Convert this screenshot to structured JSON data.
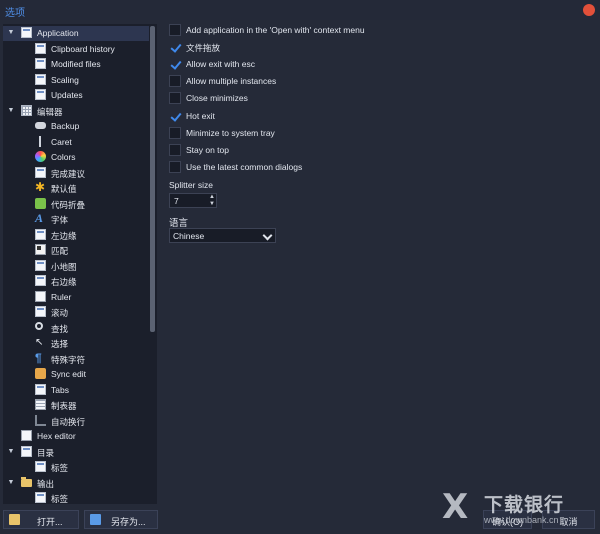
{
  "window": {
    "title": "选项"
  },
  "tree": {
    "items": [
      {
        "label": "Application",
        "icon": "window-icon",
        "level": 0,
        "expanded": true,
        "selected": true
      },
      {
        "label": "Clipboard history",
        "icon": "clipboard-icon",
        "level": 1
      },
      {
        "label": "Modified files",
        "icon": "page-icon",
        "level": 1
      },
      {
        "label": "Scaling",
        "icon": "scaling-icon",
        "level": 1
      },
      {
        "label": "Updates",
        "icon": "updates-icon",
        "level": 1
      },
      {
        "label": "编辑器",
        "icon": "editor-icon",
        "level": 0,
        "expanded": true
      },
      {
        "label": "Backup",
        "icon": "disk-icon",
        "level": 1
      },
      {
        "label": "Caret",
        "icon": "caret-icon",
        "level": 1
      },
      {
        "label": "Colors",
        "icon": "colors-icon",
        "level": 1
      },
      {
        "label": "完成建议",
        "icon": "completion-icon",
        "level": 1
      },
      {
        "label": "默认值",
        "icon": "star-icon",
        "level": 1
      },
      {
        "label": "代码折叠",
        "icon": "fold-icon",
        "level": 1
      },
      {
        "label": "字体",
        "icon": "font-icon",
        "level": 1
      },
      {
        "label": "左边缘",
        "icon": "left-margin-icon",
        "level": 1
      },
      {
        "label": "匹配",
        "icon": "match-icon",
        "level": 1
      },
      {
        "label": "小地图",
        "icon": "minimap-icon",
        "level": 1
      },
      {
        "label": "右边缘",
        "icon": "right-margin-icon",
        "level": 1
      },
      {
        "label": "Ruler",
        "icon": "ruler-icon",
        "level": 1
      },
      {
        "label": "滚动",
        "icon": "scroll-icon",
        "level": 1
      },
      {
        "label": "查找",
        "icon": "search-icon",
        "level": 1
      },
      {
        "label": "选择",
        "icon": "cursor-icon",
        "level": 1
      },
      {
        "label": "特殊字符",
        "icon": "pilcrow-icon",
        "level": 1
      },
      {
        "label": "Sync edit",
        "icon": "sync-edit-icon",
        "level": 1
      },
      {
        "label": "Tabs",
        "icon": "tabs-icon",
        "level": 1
      },
      {
        "label": "制表器",
        "icon": "table-icon",
        "level": 1
      },
      {
        "label": "自动换行",
        "icon": "wrap-icon",
        "level": 1
      },
      {
        "label": "Hex editor",
        "icon": "hex-icon",
        "level": 0
      },
      {
        "label": "目录",
        "icon": "directory-icon",
        "level": 0,
        "expanded": true
      },
      {
        "label": "标签",
        "icon": "page-icon",
        "level": 1
      },
      {
        "label": "输出",
        "icon": "folder-icon",
        "level": 0,
        "expanded": true
      },
      {
        "label": "标签",
        "icon": "page-icon",
        "level": 1
      }
    ]
  },
  "buttons": {
    "open": "打开...",
    "save_as": "另存为...",
    "ok": "确认(O)",
    "cancel": "取消"
  },
  "options": [
    {
      "label": "Add application in the 'Open with' context menu",
      "checked": false
    },
    {
      "label": "文件拖放",
      "checked": true
    },
    {
      "label": "Allow exit with esc",
      "checked": true
    },
    {
      "label": "Allow multiple instances",
      "checked": false
    },
    {
      "label": "Close minimizes",
      "checked": false
    },
    {
      "label": "Hot exit",
      "checked": true
    },
    {
      "label": "Minimize to system tray",
      "checked": false
    },
    {
      "label": "Stay on top",
      "checked": false
    },
    {
      "label": "Use the latest common dialogs",
      "checked": false
    }
  ],
  "splitter": {
    "label": "Splitter size",
    "value": "7"
  },
  "language": {
    "label": "语言",
    "value": "Chinese"
  },
  "watermark": {
    "logo": "X",
    "text": "下载银行",
    "url": "www.downbank.cn"
  },
  "colors": {
    "accent": "#3f89ec",
    "title": "#4f8ee6",
    "close": "#e2503a",
    "background": "#252a38",
    "tree_bg": "#1b1f2b"
  }
}
